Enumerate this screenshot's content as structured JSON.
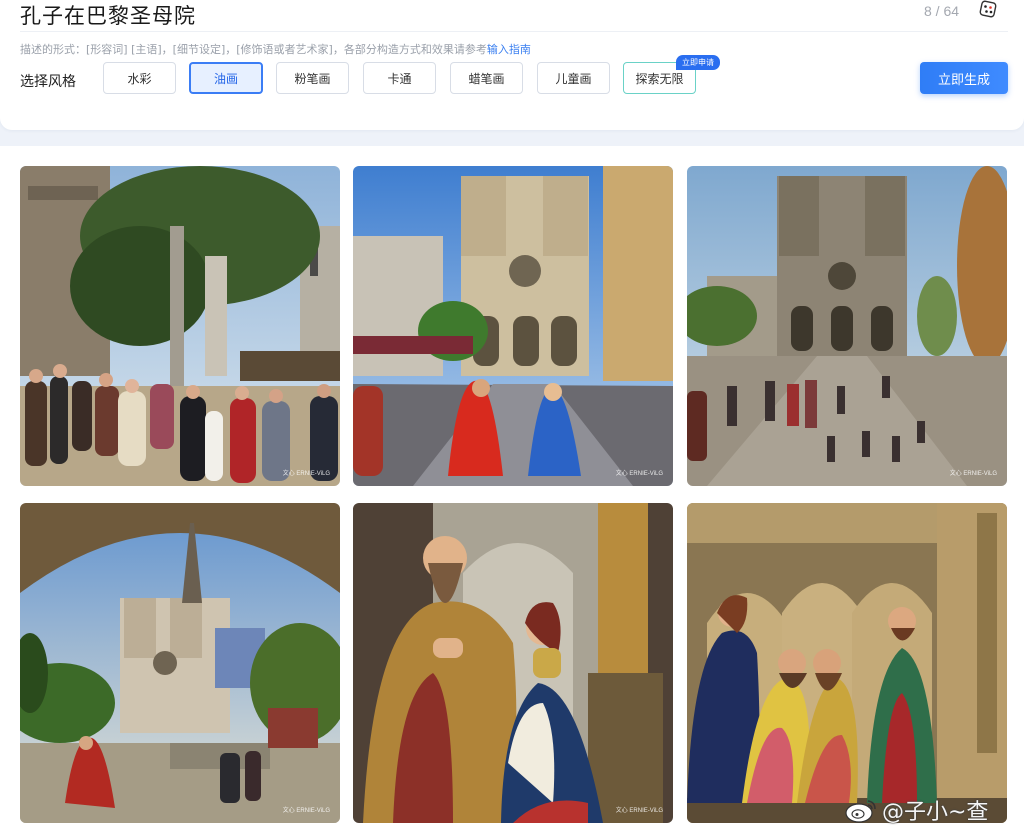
{
  "prompt": {
    "title": "孔子在巴黎圣母院",
    "counter": "8 / 64",
    "dice_icon": "dice-icon"
  },
  "hint": {
    "text": "描述的形式：[形容词] [主语]，[细节设定]，[修饰语或者艺术家]，各部分构造方式和效果请参考",
    "link": "输入指南"
  },
  "style_selector": {
    "label": "选择风格",
    "options": [
      "水彩",
      "油画",
      "粉笔画",
      "卡通",
      "蜡笔画",
      "儿童画",
      "探索无限"
    ],
    "selected": "油画",
    "badge": "立即申请"
  },
  "generate_button": "立即生成",
  "gallery": {
    "watermark": "文心 ERNIE-ViLG",
    "images": [
      "notre-dame-square-procession",
      "notre-dame-street-two-figures",
      "notre-dame-plaza-crowd",
      "notre-dame-arch-view",
      "sage-and-woman-interior",
      "gothic-chapel-figures"
    ]
  },
  "social_watermark": {
    "text": "@子小~查",
    "icon": "weibo-icon"
  },
  "colors": {
    "accent": "#3b7df5",
    "button": "#2f7df6",
    "hint_link": "#3a7ff0",
    "page_bg": "#eef2f9"
  }
}
